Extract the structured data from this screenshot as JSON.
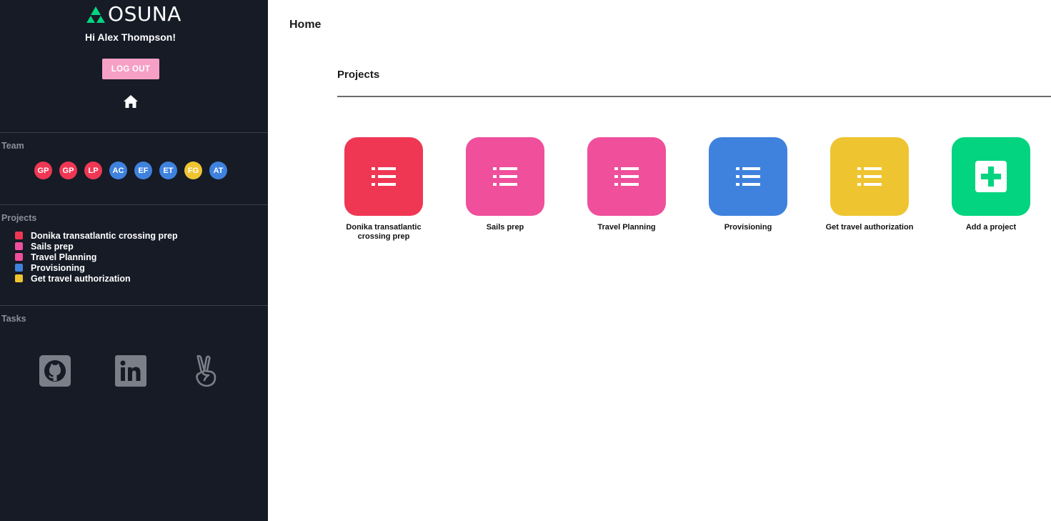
{
  "app": {
    "logo_text": "OSUNA",
    "greeting": "Hi Alex Thompson!",
    "logout_label": "LOG OUT"
  },
  "colors": {
    "sidebar_bg": "#161b26",
    "red": "#ef3754",
    "pink": "#ef4f9b",
    "blue": "#3f82de",
    "yellow": "#efc431",
    "green": "#02d47f",
    "logout_pink": "#f6a0c6"
  },
  "sidebar": {
    "team_label": "Team",
    "team": [
      {
        "initials": "GP",
        "color": "#ef3754"
      },
      {
        "initials": "GP",
        "color": "#ef3754"
      },
      {
        "initials": "LP",
        "color": "#ef3754"
      },
      {
        "initials": "AC",
        "color": "#3f82de"
      },
      {
        "initials": "EF",
        "color": "#3f82de"
      },
      {
        "initials": "ET",
        "color": "#3f82de"
      },
      {
        "initials": "FG",
        "color": "#efc431"
      },
      {
        "initials": "AT",
        "color": "#3f82de"
      }
    ],
    "projects_label": "Projects",
    "projects": [
      {
        "name": "Donika transatlantic crossing prep",
        "color": "#ef3754"
      },
      {
        "name": "Sails prep",
        "color": "#ef4f9b"
      },
      {
        "name": "Travel Planning",
        "color": "#ef4f9b"
      },
      {
        "name": "Provisioning",
        "color": "#3f82de"
      },
      {
        "name": "Get travel authorization",
        "color": "#efc431"
      }
    ],
    "tasks_label": "Tasks",
    "social": [
      "github-icon",
      "linkedin-icon",
      "angellist-icon"
    ]
  },
  "main": {
    "page_title": "Home",
    "projects_title": "Projects",
    "tiles": [
      {
        "label": "Donika transatlantic crossing prep",
        "color": "#ef3754",
        "icon": "list-icon"
      },
      {
        "label": "Sails prep",
        "color": "#ef4f9b",
        "icon": "list-icon"
      },
      {
        "label": "Travel Planning",
        "color": "#ef4f9b",
        "icon": "list-icon"
      },
      {
        "label": "Provisioning",
        "color": "#3f82de",
        "icon": "list-icon"
      },
      {
        "label": "Get travel authorization",
        "color": "#efc431",
        "icon": "list-icon"
      },
      {
        "label": "Add a project",
        "color": "#02d47f",
        "icon": "plus-square-icon"
      }
    ]
  }
}
